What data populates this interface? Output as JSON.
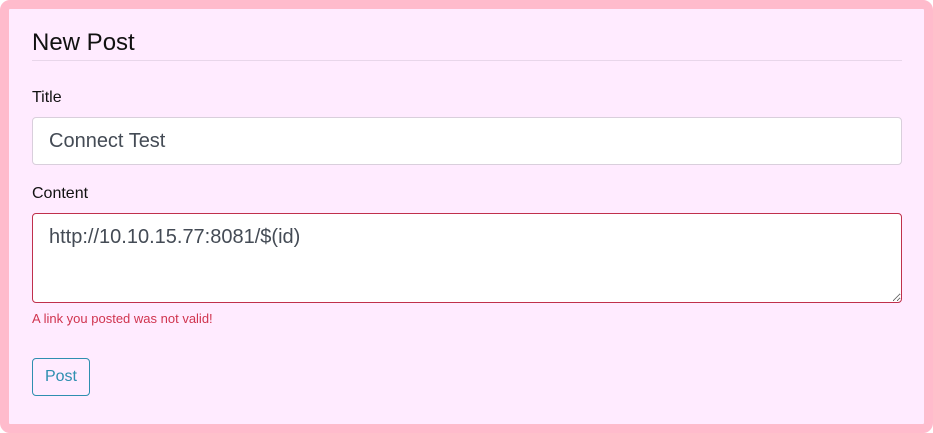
{
  "form": {
    "heading": "New Post",
    "title_label": "Title",
    "title_value": "Connect Test",
    "content_label": "Content",
    "content_value": "http://10.10.15.77:8081/$(id)",
    "error_message": "A link you posted was not valid!",
    "submit_label": "Post"
  },
  "colors": {
    "card_border": "#ffbbcc",
    "card_background": "#ffebff",
    "error": "#d0344f",
    "button_accent": "#2e8fb0"
  }
}
